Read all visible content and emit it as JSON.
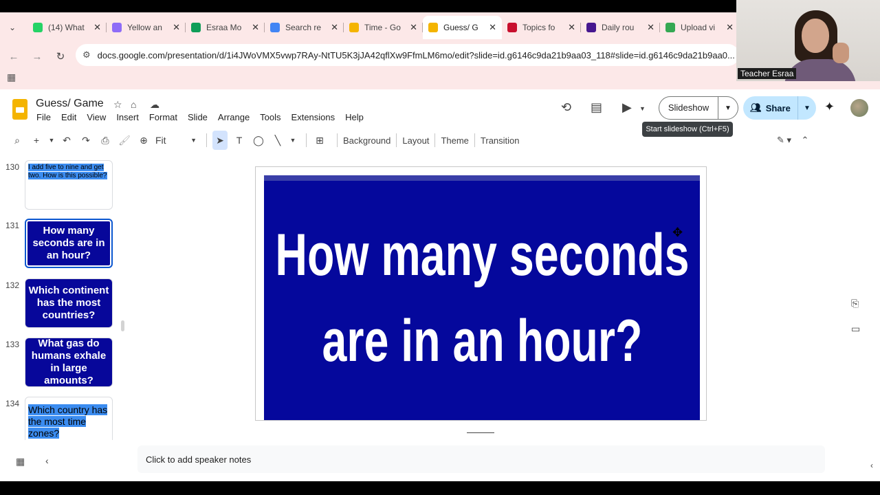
{
  "browser": {
    "tabs": [
      {
        "title": "(14) What",
        "color": "#25d366",
        "icon": "whatsapp-icon"
      },
      {
        "title": "Yellow an",
        "color": "#8e6cf7",
        "icon": "canva-icon"
      },
      {
        "title": "Esraa Mo",
        "color": "#0f9d58",
        "icon": "sheets-icon"
      },
      {
        "title": "Search re",
        "color": "#4285f4",
        "icon": "drive-icon"
      },
      {
        "title": "Time - Go",
        "color": "#f4b400",
        "icon": "slides-icon"
      },
      {
        "title": "Guess/ G",
        "color": "#f4b400",
        "icon": "slides-icon"
      },
      {
        "title": "Topics fo",
        "color": "#c8102e",
        "icon": "uk-flag-icon"
      },
      {
        "title": "Daily rou",
        "color": "#46178f",
        "icon": "kahoot-icon"
      },
      {
        "title": "Upload vi",
        "color": "#34a853",
        "icon": "play-icon"
      }
    ],
    "active_tab": 5,
    "url": "docs.google.com/presentation/d/1i4JWoVMX5vwp7RAy-NtTU5K3jJA42qflXw9FfmLM6mo/edit?slide=id.g6146c9da21b9aa03_118#slide=id.g6146c9da21b9aa0..."
  },
  "webcam": {
    "name": "Teacher Esraa"
  },
  "app": {
    "title": "Guess/ Game",
    "menu": [
      "File",
      "Edit",
      "View",
      "Insert",
      "Format",
      "Slide",
      "Arrange",
      "Tools",
      "Extensions",
      "Help"
    ],
    "slideshow_label": "Slideshow",
    "share_label": "Share",
    "tooltip": "Start slideshow (Ctrl+F5)"
  },
  "toolbar": {
    "zoom": "Fit",
    "background": "Background",
    "layout": "Layout",
    "theme": "Theme",
    "transition": "Transition"
  },
  "filmstrip": [
    {
      "num": "130",
      "text": "I add five to nine and get two. How is this possible?",
      "style": "highlight-small"
    },
    {
      "num": "131",
      "text": "How many seconds are in an hour?",
      "style": "blue",
      "selected": true
    },
    {
      "num": "132",
      "text": "Which continent has the most countries?",
      "style": "blue"
    },
    {
      "num": "133",
      "text": "What gas do humans exhale in large amounts?",
      "style": "blue"
    },
    {
      "num": "134",
      "text": "Which country has the most time zones?",
      "style": "highlight-large"
    }
  ],
  "slide": {
    "line1": "How many seconds",
    "line2": "are in an hour?",
    "bg": "#05089c"
  },
  "notes": {
    "placeholder": "Click to add speaker notes"
  }
}
